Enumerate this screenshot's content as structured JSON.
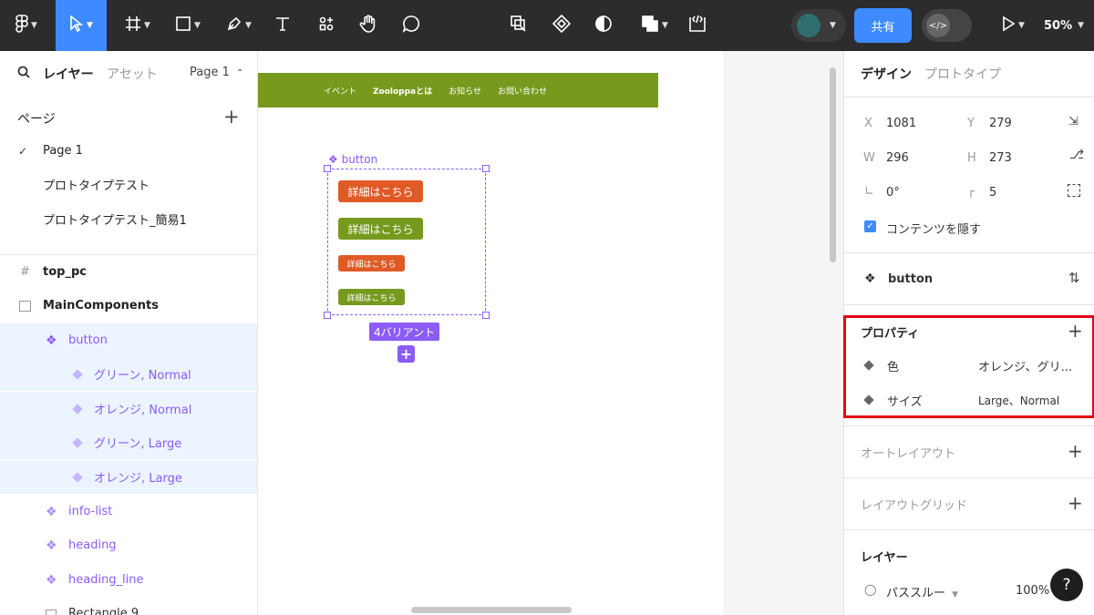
{
  "toolbar": {
    "tools": [
      {
        "name": "main-menu",
        "icon": "figma-logo-icon"
      },
      {
        "name": "move-tool",
        "icon": "pointer-icon",
        "active": true
      },
      {
        "name": "frame-tool",
        "icon": "frame-icon"
      },
      {
        "name": "shape-tool",
        "icon": "rectangle-icon"
      },
      {
        "name": "pen-tool",
        "icon": "pen-icon"
      },
      {
        "name": "text-tool",
        "icon": "text-icon"
      },
      {
        "name": "resources-tool",
        "icon": "resources-icon"
      },
      {
        "name": "hand-tool",
        "icon": "hand-icon"
      },
      {
        "name": "comment-tool",
        "icon": "comment-icon"
      }
    ],
    "share_label": "共有",
    "zoom_label": "50%",
    "accent_color": "#3d8bff"
  },
  "left_panel": {
    "tab_layers": "レイヤー",
    "tab_assets": "アセット",
    "page_selector": "Page 1",
    "pages_title": "ページ",
    "pages": [
      "Page 1",
      "プロトタイプテスト",
      "プロトタイプテスト_簡易1"
    ],
    "layers": {
      "top_pc": "top_pc",
      "main_components": "MainComponents",
      "button": "button",
      "variants": [
        "グリーン, Normal",
        "オレンジ, Normal",
        "グリーン, Large",
        "オレンジ, Large"
      ],
      "info_list": "info-list",
      "heading": "heading",
      "heading_line": "heading_line",
      "rectangle": "Rectangle 9"
    }
  },
  "canvas": {
    "nav_items": [
      "イベント",
      "Zooloppaとは",
      "お知らせ",
      "お問い合わせ"
    ],
    "nav_color": "#779a1e",
    "component_set_label": "button",
    "button_label": "詳細はこちら",
    "orange": "#e05a26",
    "green": "#779a1e",
    "variant_count_label": "4バリアント"
  },
  "right_panel": {
    "tab_design": "デザイン",
    "tab_prototype": "プロトタイプ",
    "x_label": "X",
    "x_value": "1081",
    "y_label": "Y",
    "y_value": "279",
    "w_label": "W",
    "w_value": "296",
    "h_label": "H",
    "h_value": "273",
    "rotation_value": "0°",
    "radius_value": "5",
    "clip_content_label": "コンテンツを隠す",
    "clip_content_checked": true,
    "component_name": "button",
    "properties_title": "プロパティ",
    "properties": [
      {
        "name": "色",
        "value": "オレンジ、グリ..."
      },
      {
        "name": "サイズ",
        "value": "Large、Normal"
      }
    ],
    "auto_layout_title": "オートレイアウト",
    "layout_grid_title": "レイアウトグリッド",
    "layer_title": "レイヤー",
    "blend_mode": "パススルー",
    "opacity": "100%",
    "highlight_color": "#e60012"
  }
}
